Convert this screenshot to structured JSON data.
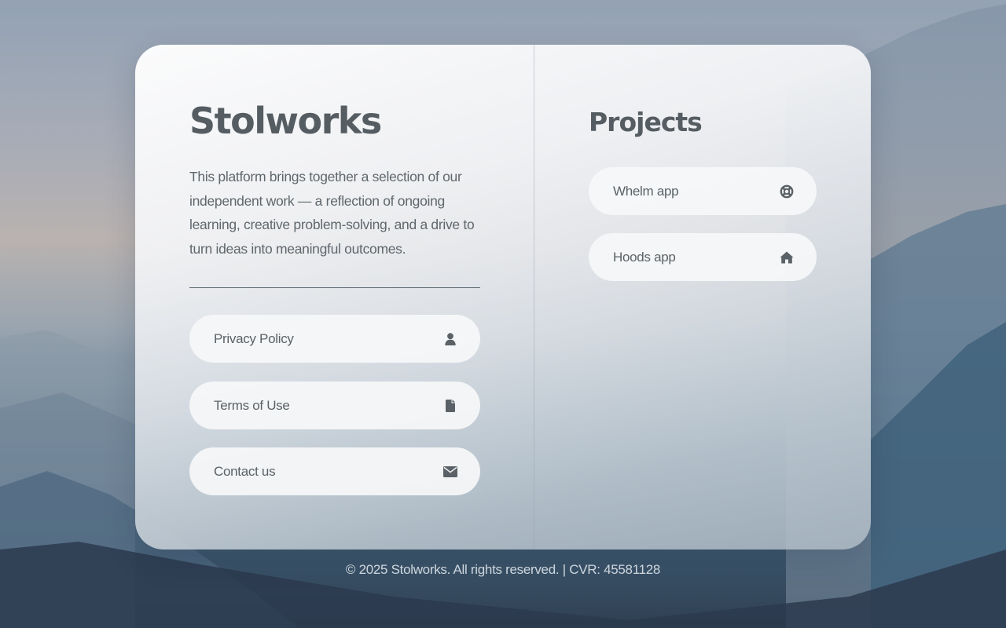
{
  "site": {
    "title": "Stolworks",
    "description": "This platform brings together a selection of our independent work — a reflection of ongoing learning, creative problem-solving, and a drive to turn ideas into meaningful outcomes."
  },
  "links": [
    {
      "label": "Privacy Policy",
      "icon": "user-icon"
    },
    {
      "label": "Terms of Use",
      "icon": "file-icon"
    },
    {
      "label": "Contact us",
      "icon": "envelope-icon"
    }
  ],
  "projects": {
    "title": "Projects",
    "items": [
      {
        "label": "Whelm app",
        "icon": "lifebuoy-icon"
      },
      {
        "label": "Hoods app",
        "icon": "home-icon"
      }
    ]
  },
  "footer": {
    "text": "© 2025 Stolworks. All rights reserved. | CVR: 45581128"
  },
  "colors": {
    "heading": "#555d62",
    "text": "#5f676c",
    "icon": "#5a6267",
    "pill_bg": "#f6f7f9"
  }
}
